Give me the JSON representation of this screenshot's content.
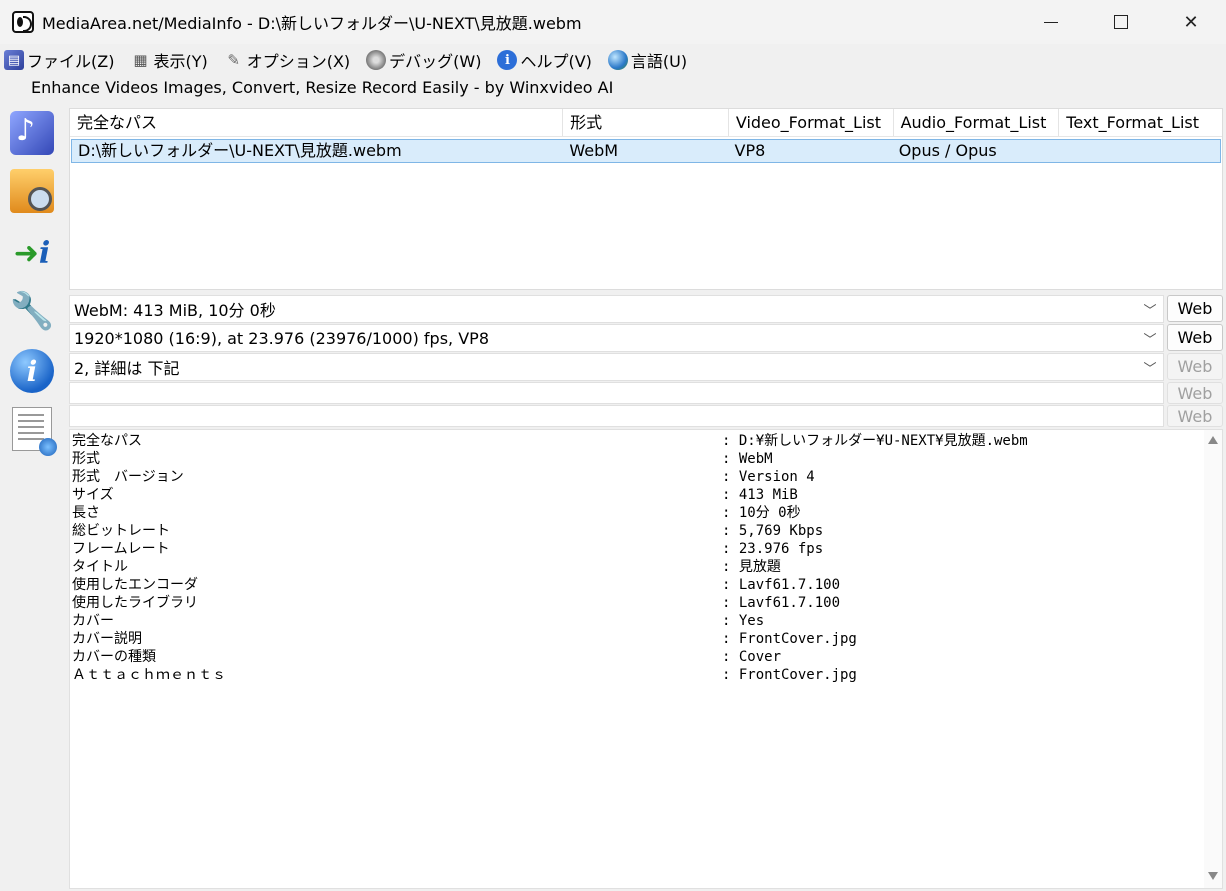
{
  "window": {
    "title": "MediaArea.net/MediaInfo - D:\\新しいフォルダー\\U-NEXT\\見放題.webm",
    "minimize": "—",
    "maximize": "☐",
    "close": "✕"
  },
  "menu": {
    "items": [
      {
        "label": "ファイル(Z)",
        "icon": "file-icon"
      },
      {
        "label": "表示(Y)",
        "icon": "view-icon"
      },
      {
        "label": "オプション(X)",
        "icon": "options-icon"
      },
      {
        "label": "デバッグ(W)",
        "icon": "debug-icon"
      },
      {
        "label": "ヘルプ(V)",
        "icon": "help-icon"
      },
      {
        "label": "言語(U)",
        "icon": "language-icon"
      }
    ]
  },
  "ad": {
    "text": "Enhance Videos  Images, Convert, Resize  Record Easily - by Winxvideo AI"
  },
  "list": {
    "headers": [
      "完全なパス",
      "形式",
      "Video_Format_List",
      "Audio_Format_List",
      "Text_Format_List"
    ],
    "rows": [
      [
        "D:\\新しいフォルダー\\U-NEXT\\見放題.webm",
        "WebM",
        "VP8",
        "Opus / Opus",
        ""
      ]
    ]
  },
  "summary": {
    "general": "WebM: 413 MiB, 10分 0秒",
    "video": "1920*1080 (16:9), at 23.976 (23976/1000) fps, VP8",
    "audio": "2, 詳細は 下記",
    "text": "",
    "other": "",
    "web_label": "Web"
  },
  "details": {
    "rows": [
      {
        "key": "完全なパス",
        "value": ": D:¥新しいフォルダー¥U-NEXT¥見放題.webm"
      },
      {
        "key": "形式",
        "value": ": WebM"
      },
      {
        "key": "形式　バージョン",
        "value": ": Version 4"
      },
      {
        "key": "サイズ",
        "value": ": 413 MiB"
      },
      {
        "key": "長さ",
        "value": ": 10分 0秒"
      },
      {
        "key": "総ビットレート",
        "value": ": 5,769 Kbps"
      },
      {
        "key": "フレームレート",
        "value": ": 23.976 fps"
      },
      {
        "key": "タイトル",
        "value": ": 見放題"
      },
      {
        "key": "使用したエンコーダ",
        "value": ": Lavf61.7.100"
      },
      {
        "key": "使用したライブラリ",
        "value": ": Lavf61.7.100"
      },
      {
        "key": "カバー",
        "value": ": Yes"
      },
      {
        "key": "カバー説明",
        "value": ": FrontCover.jpg"
      },
      {
        "key": "カバーの種類",
        "value": ": Cover"
      },
      {
        "key": "Ａｔｔａｃｈｍｅｎｔｓ",
        "value": ": FrontCover.jpg"
      }
    ]
  }
}
